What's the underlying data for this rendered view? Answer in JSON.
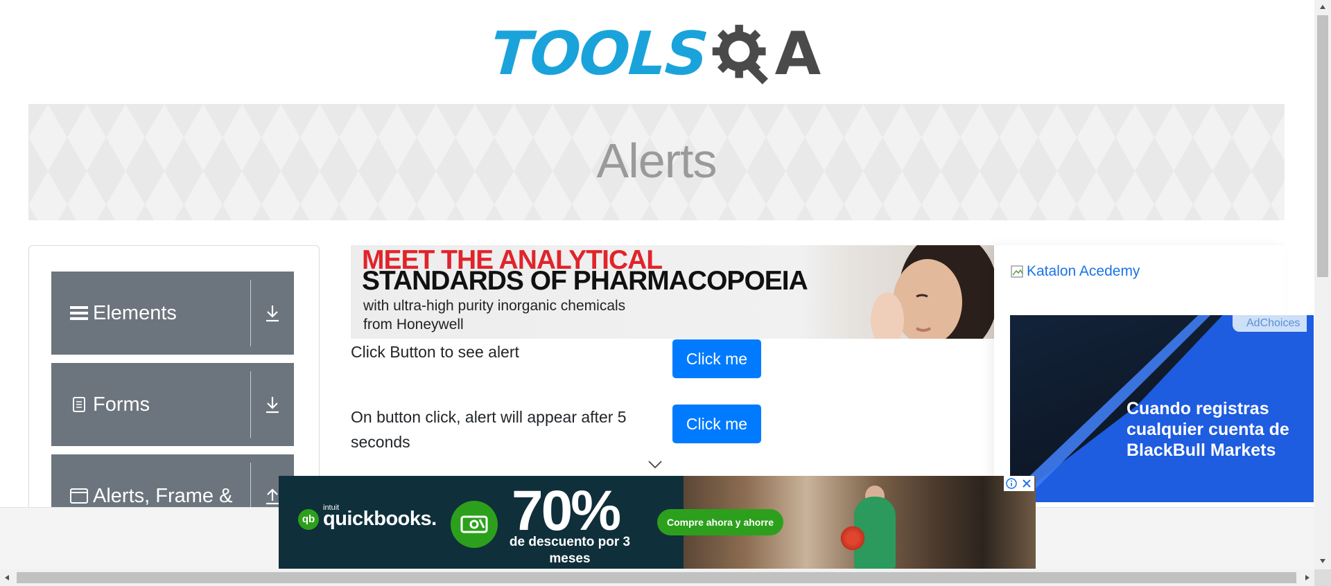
{
  "header": {
    "logo_tools": "TOOLS",
    "logo_a": "A"
  },
  "banner": {
    "title": "Alerts"
  },
  "sidebar": {
    "groups": [
      {
        "label": "Elements",
        "icon": "hamburger-icon",
        "toggle": "download-icon"
      },
      {
        "label": "Forms",
        "icon": "document-icon",
        "toggle": "download-icon"
      },
      {
        "label": "Alerts, Frame &",
        "icon": "window-icon",
        "toggle": "upload-icon"
      }
    ]
  },
  "ads": {
    "top": {
      "line1": "MEET THE ANALYTICAL",
      "line2": "STANDARDS OF PHARMACOPOEIA",
      "line3": "with ultra-high purity inorganic chemicals",
      "line4": "from Honeywell"
    },
    "right": {
      "broken_image_alt": "Katalon Acedemy",
      "adchoices": "AdChoices",
      "text": "Cuando registras cualquier cuenta de BlackBull Markets"
    },
    "bottom": {
      "brand_small": "intuit",
      "brand": "quickbooks.",
      "percent": "70%",
      "desc": "de descuento por 3 meses",
      "cta": "Compre ahora y ahorre"
    }
  },
  "alerts": {
    "rows": [
      {
        "text": "Click Button to see alert",
        "button": "Click me"
      },
      {
        "text": "On button click, alert will appear after 5 seconds",
        "button": "Click me"
      }
    ]
  },
  "colors": {
    "primary": "#007bff",
    "menu_bg": "#6c757d",
    "logo_blue": "#1aa3da",
    "logo_gray": "#4a4a4a"
  }
}
